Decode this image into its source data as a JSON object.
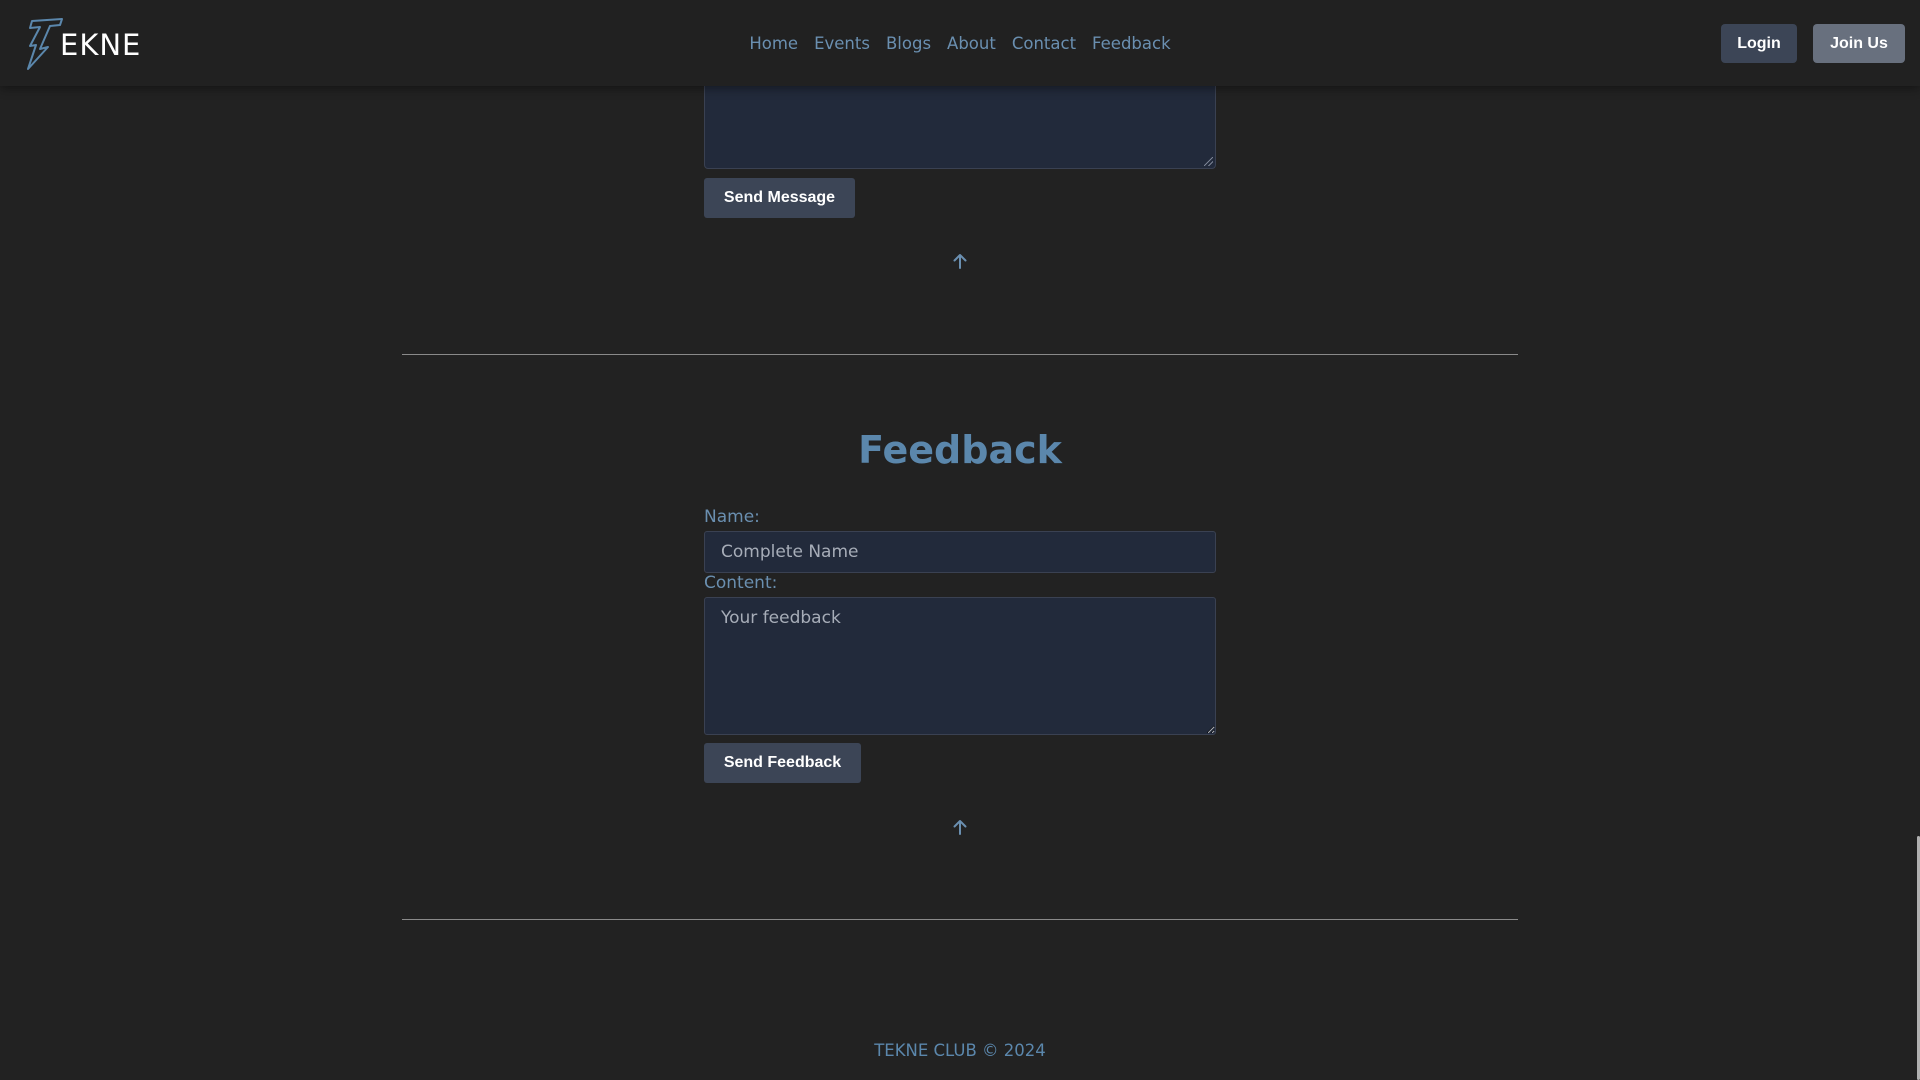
{
  "brand": {
    "logo_text": "EKNE",
    "logo_icon": "lightning-t-icon"
  },
  "nav": {
    "items": [
      "Home",
      "Events",
      "Blogs",
      "About",
      "Contact",
      "Feedback"
    ]
  },
  "auth": {
    "login_label": "Login",
    "join_label": "Join Us"
  },
  "contact": {
    "send_label": "Send Message",
    "back_to_top_icon": "arrow-up-icon"
  },
  "feedback": {
    "title": "Feedback",
    "name_label": "Name:",
    "name_placeholder": "Complete Name",
    "content_label": "Content:",
    "content_placeholder": "Your feedback",
    "send_label": "Send Feedback",
    "back_to_top_icon": "arrow-up-icon"
  },
  "footer": {
    "text": "TEKNE CLUB © 2024"
  },
  "colors": {
    "background": "#222222",
    "accent": "#5b87ac",
    "link": "#6a8fb0",
    "button_dark": "#3c4556",
    "button_light": "#68707e",
    "field_bg": "#222a3b"
  }
}
